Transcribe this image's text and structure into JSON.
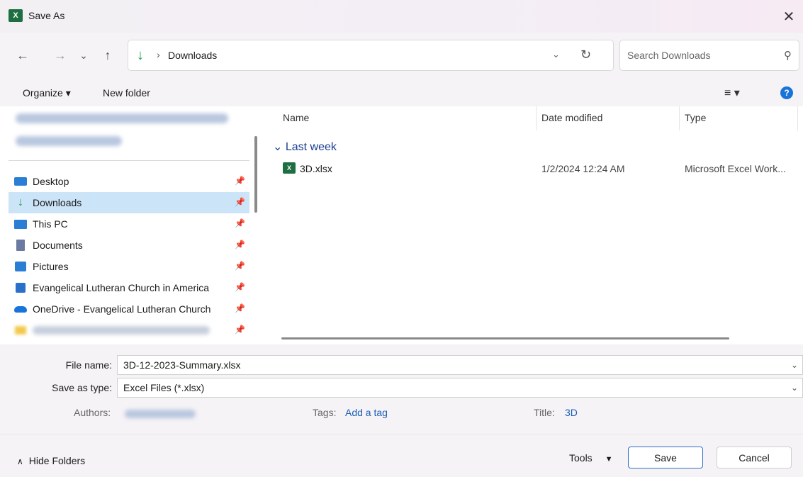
{
  "window": {
    "title": "Save As",
    "app_icon": "excel-icon",
    "close_glyph": "✕"
  },
  "nav": {
    "back_glyph": "←",
    "forward_glyph": "→",
    "recent_glyph": "⌄",
    "up_glyph": "↑",
    "path_glyph": "›",
    "address": "Downloads",
    "search_placeholder": "Search Downloads"
  },
  "toolbar": {
    "organize": "Organize ▾",
    "new_folder": "New folder",
    "view": "≡ ▾",
    "help": "?"
  },
  "sidebar": {
    "items": [
      {
        "label": "Desktop",
        "icon": "desktop-icon",
        "color": "#2a7fd4"
      },
      {
        "label": "Downloads",
        "icon": "download-icon",
        "color": "#1a9e4f",
        "selected": true
      },
      {
        "label": "This PC",
        "icon": "monitor-icon",
        "color": "#2a7fd4"
      },
      {
        "label": "Documents",
        "icon": "documents-icon",
        "color": "#6a7aa0"
      },
      {
        "label": "Pictures",
        "icon": "pictures-icon",
        "color": "#2a7fd4"
      },
      {
        "label": "Evangelical Lutheran Church in America",
        "icon": "building-icon",
        "color": "#2a6fc9"
      },
      {
        "label": "OneDrive - Evangelical Lutheran Church",
        "icon": "onedrive-icon",
        "color": "#1a73d9"
      }
    ]
  },
  "files": {
    "columns": [
      "Name",
      "Date modified",
      "Type"
    ],
    "group": "Last week",
    "rows": [
      {
        "name": "3D.xlsx",
        "date": "1/2/2024 12:24 AM",
        "type": "Microsoft Excel Work..."
      }
    ]
  },
  "form": {
    "file_name_label": "File name:",
    "file_name": "3D-12-2023-Summary.xlsx",
    "type_label": "Save as type:",
    "type_value": "Excel Files (*.xlsx)",
    "authors_label": "Authors:",
    "tags_label": "Tags:",
    "tags_value": "Add a tag",
    "title_label": "Title:",
    "title_value": "3D"
  },
  "footer": {
    "hide_folders": "Hide Folders",
    "tools": "Tools",
    "save": "Save",
    "cancel": "Cancel"
  }
}
